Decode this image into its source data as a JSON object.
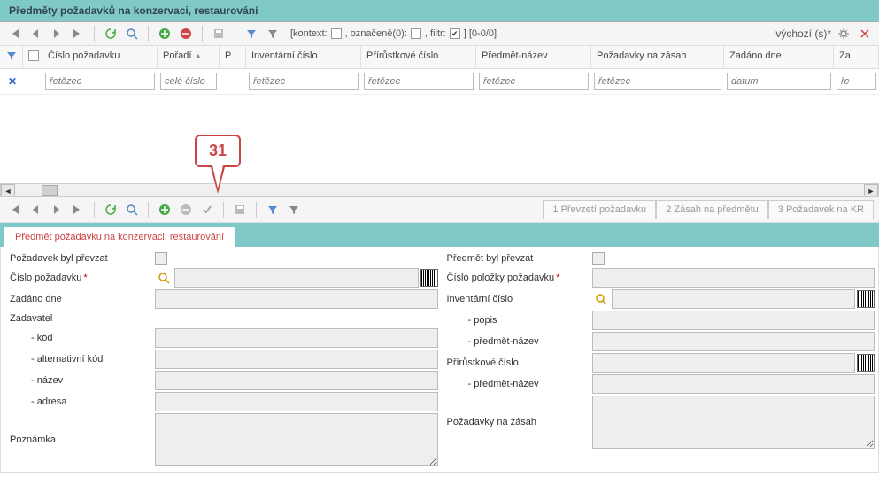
{
  "header": {
    "title": "Předměty požadavků na konzervaci, restaurování"
  },
  "toolbar1": {
    "context_label": "[kontext:",
    "marked_label": ", označené(0):",
    "filter_label": ", filtr:",
    "count_label": "]  [0-0/0]",
    "preset": "výchozí (s)*"
  },
  "columns": {
    "c1": "Číslo požadavku",
    "c2": "Pořadí",
    "c3": "P",
    "c4": "Inventární číslo",
    "c5": "Přírůstkové číslo",
    "c6": "Předmět-název",
    "c7": "Požadavky na zásah",
    "c8": "Zadáno dne",
    "c9": "Za"
  },
  "filters": {
    "ph_str": "řetězec",
    "ph_int": "celé číslo",
    "ph_date": "datum",
    "ph_short": "ře"
  },
  "callout": {
    "num": "31"
  },
  "actions": {
    "a1": "1 Převzetí požadavku",
    "a2": "2 Zásah na předmětu",
    "a3": "3 Požadavek na KR"
  },
  "tab": {
    "label": "Předmět požadavku na konzervaci, restaurování"
  },
  "form": {
    "l_prevzat": "Požadavek byl převzat",
    "l_cislo": "Číslo požadavku",
    "l_zadano": "Zadáno dne",
    "l_zadavatel": "Zadavatel",
    "l_kod": "- kód",
    "l_altkod": "- alternativní kód",
    "l_nazev": "- název",
    "l_adresa": "- adresa",
    "l_pozn": "Poznámka",
    "r_prevzat": "Předmět byl převzat",
    "r_polozka": "Číslo položky požadavku",
    "r_inv": "Inventární číslo",
    "r_popis": "- popis",
    "r_prednaz": "- předmět-název",
    "r_prir": "Přírůstkové číslo",
    "r_prednaz2": "- předmět-název",
    "r_pozzas": "Požadavky na zásah"
  }
}
